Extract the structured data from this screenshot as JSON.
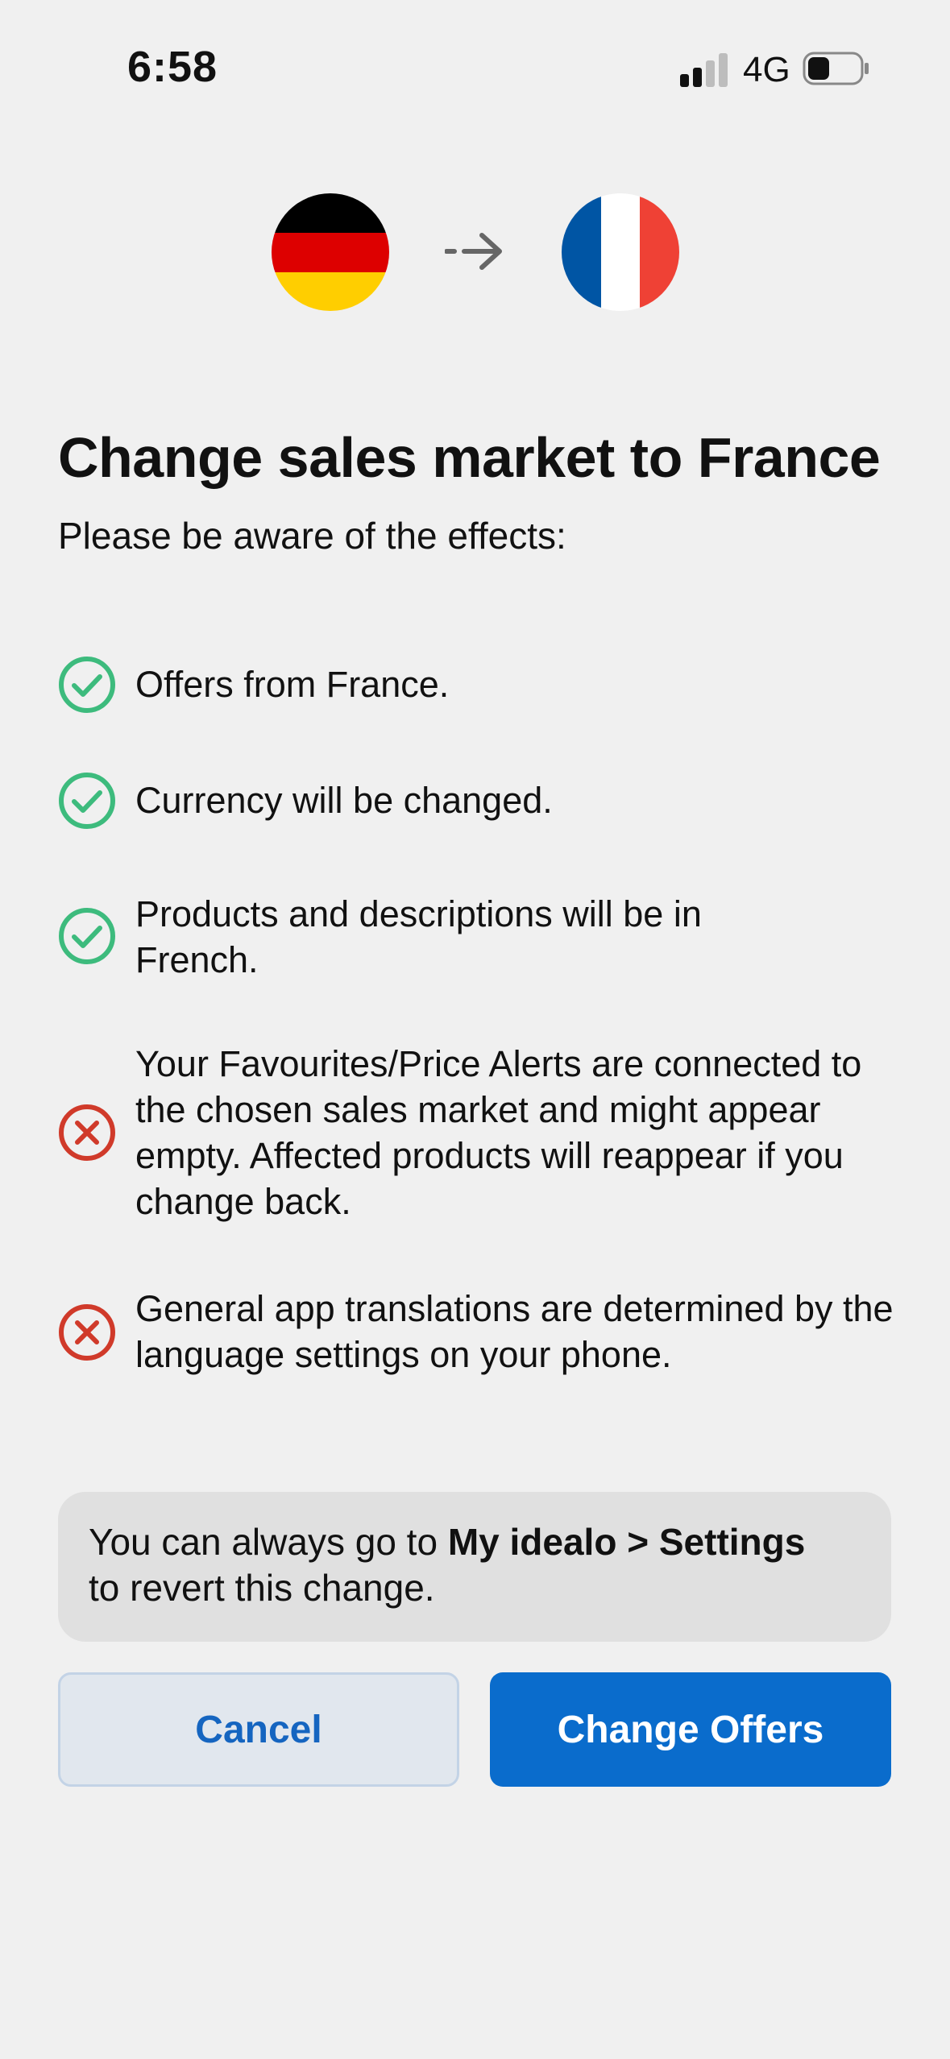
{
  "status_bar": {
    "time": "6:58",
    "network": "4G"
  },
  "header": {
    "from_flag": "germany-flag",
    "to_flag": "france-flag"
  },
  "title": "Change sales market to France",
  "subtitle": "Please be aware of the effects:",
  "effects": [
    {
      "type": "positive",
      "icon": "check-circle-icon",
      "text": "Offers from France."
    },
    {
      "type": "positive",
      "icon": "check-circle-icon",
      "text": "Currency will be changed."
    },
    {
      "type": "positive",
      "icon": "check-circle-icon",
      "text": "Products and descriptions will be in French."
    },
    {
      "type": "negative",
      "icon": "x-circle-icon",
      "text": "Your Favourites/Price Alerts are connected to the chosen sales market and might appear empty. Affected products will reappear if you change back."
    },
    {
      "type": "negative",
      "icon": "x-circle-icon",
      "text": "General app translations are determined by the language settings on your phone."
    }
  ],
  "info": {
    "prefix": "You can always go to ",
    "bold": "My idealo > Settings",
    "suffix": " to revert this change."
  },
  "buttons": {
    "cancel": "Cancel",
    "confirm": "Change Offers"
  },
  "colors": {
    "positive": "#3dbb7d",
    "negative": "#d03a2a",
    "primary": "#0a6ccc"
  }
}
